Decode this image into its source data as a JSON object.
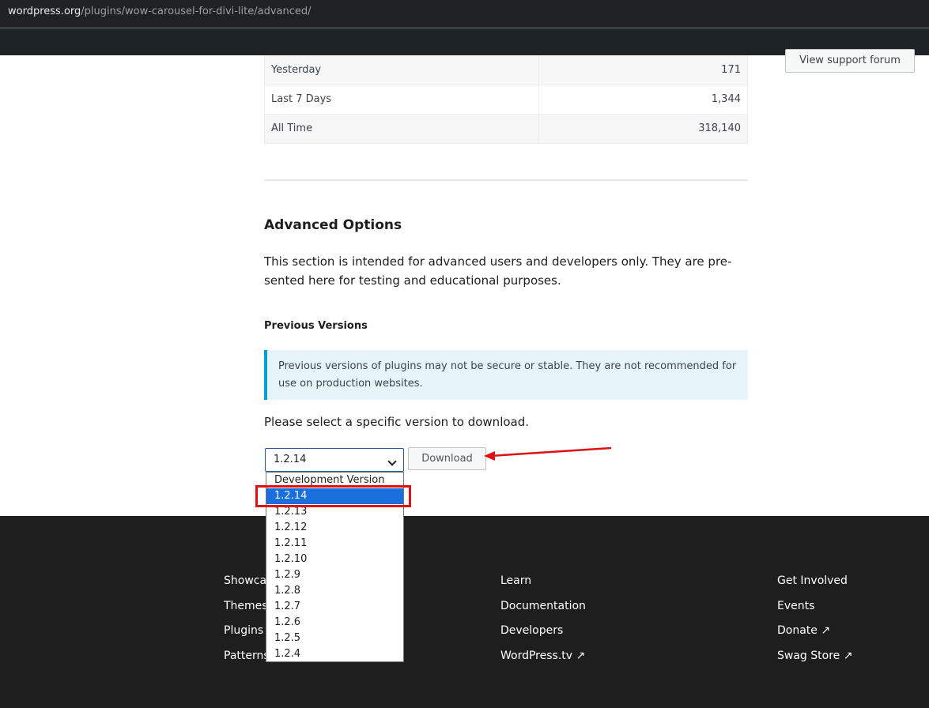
{
  "browser": {
    "url_host": "wordpress.org",
    "url_path": "/plugins/wow-carousel-for-divi-lite/advanced/"
  },
  "sidebar": {
    "support_button": "View support forum"
  },
  "downloads": {
    "rows": [
      {
        "label": "Yesterday",
        "value": "171"
      },
      {
        "label": "Last 7 Days",
        "value": "1,344"
      },
      {
        "label": "All Time",
        "value": "318,140"
      }
    ]
  },
  "advanced": {
    "title": "Advanced Options",
    "description": "This section is intended for advanced users and developers only. They are pre-sented here for testing and educational purposes.",
    "previous_title": "Previous Versions",
    "notice": "Previous versions of plugins may not be secure or stable. They are not recommended for use on production websites.",
    "select_prompt": "Please select a specific version to download.",
    "selected_version": "1.2.14",
    "download_label": "Download",
    "options": [
      "Development Version",
      "1.2.14",
      "1.2.13",
      "1.2.12",
      "1.2.11",
      "1.2.10",
      "1.2.9",
      "1.2.8",
      "1.2.7",
      "1.2.6",
      "1.2.5",
      "1.2.4"
    ]
  },
  "footer": {
    "col1": [
      "Showca",
      "Themes",
      "Plugins",
      "Patterns"
    ],
    "col2": [
      "Learn",
      "Documentation",
      "Developers",
      "WordPress.tv ↗"
    ],
    "col3": [
      "Get Involved",
      "Events",
      "Donate ↗",
      "Swag Store ↗"
    ]
  },
  "colors": {
    "highlight": "#e01010",
    "selected_option": "#1a6fdc",
    "notice_border": "#00a0d2"
  }
}
